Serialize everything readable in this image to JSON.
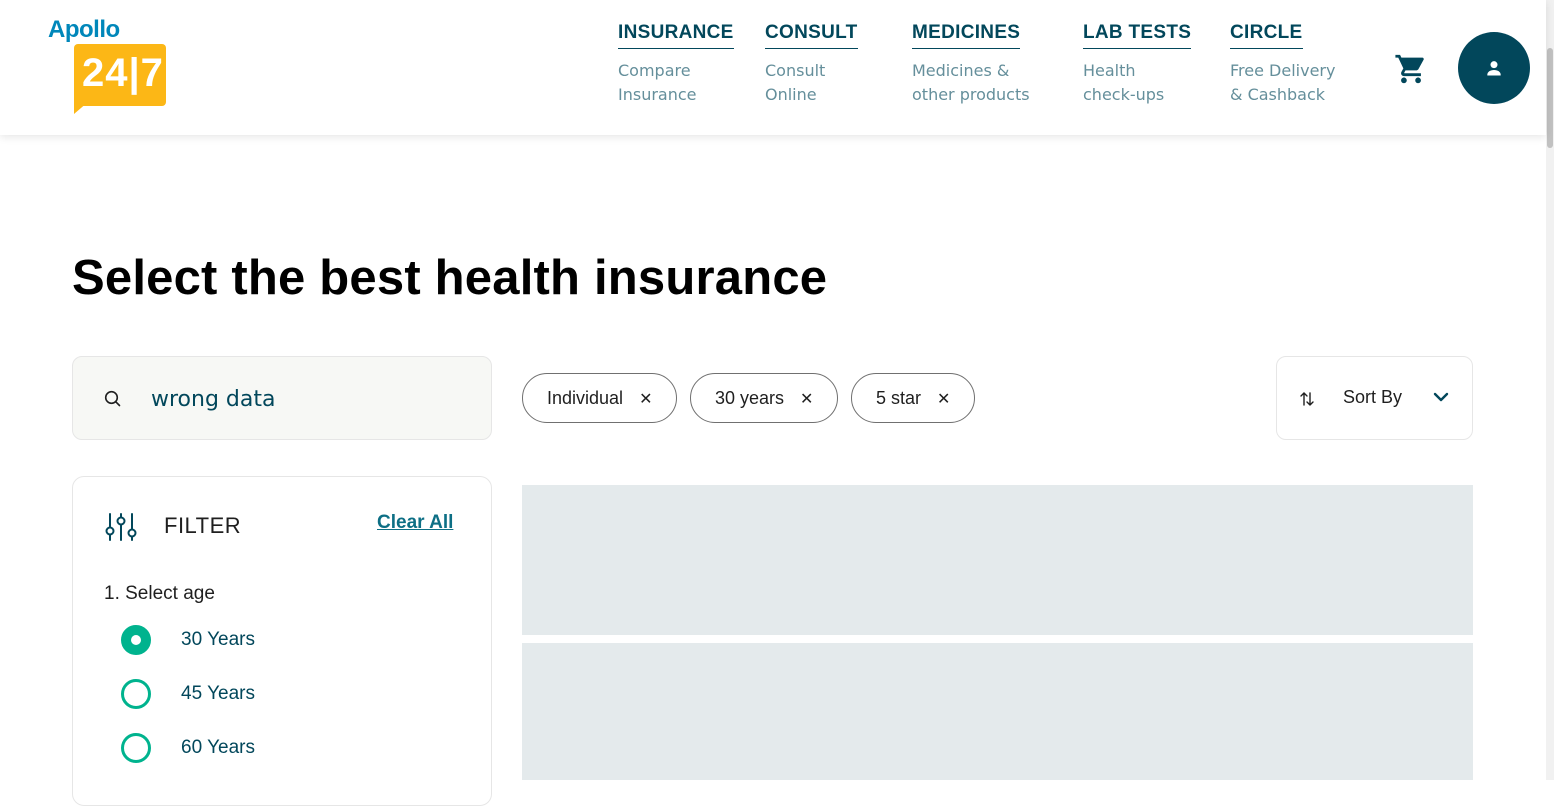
{
  "brand": {
    "wordmark": "Apollo",
    "number": "24|7",
    "accent_color": "#fcb716",
    "primary_color": "#02475b"
  },
  "nav": [
    {
      "title": "INSURANCE",
      "sub": "Compare Insurance"
    },
    {
      "title": "CONSULT",
      "sub": "Consult Online"
    },
    {
      "title": "MEDICINES",
      "sub": "Medicines & other products"
    },
    {
      "title": "LAB TESTS",
      "sub": "Health check-ups"
    },
    {
      "title": "CIRCLE",
      "sub": "Free Delivery & Cashback"
    }
  ],
  "header_icons": {
    "cart": "cart-icon",
    "profile": "user-icon"
  },
  "page": {
    "title": "Select the best health insurance"
  },
  "search": {
    "value": "wrong data",
    "icon": "search-icon"
  },
  "chips": [
    {
      "label": "Individual",
      "remove_icon": "close-icon"
    },
    {
      "label": "30 years",
      "remove_icon": "close-icon"
    },
    {
      "label": "5 star",
      "remove_icon": "close-icon"
    }
  ],
  "sort": {
    "label": "Sort By",
    "icon": "sort-arrows-icon",
    "chevron": "chevron-down-icon"
  },
  "filter": {
    "title": "FILTER",
    "clear_label": "Clear All",
    "icon": "sliders-icon",
    "sections": [
      {
        "label": "1. Select age",
        "options": [
          {
            "label": "30 Years",
            "checked": true
          },
          {
            "label": "45 Years",
            "checked": false
          },
          {
            "label": "60 Years",
            "checked": false
          }
        ]
      }
    ]
  },
  "colors": {
    "radio_accent": "#00b38e",
    "skeleton": "#e4eaec",
    "link": "#0d6f85"
  }
}
